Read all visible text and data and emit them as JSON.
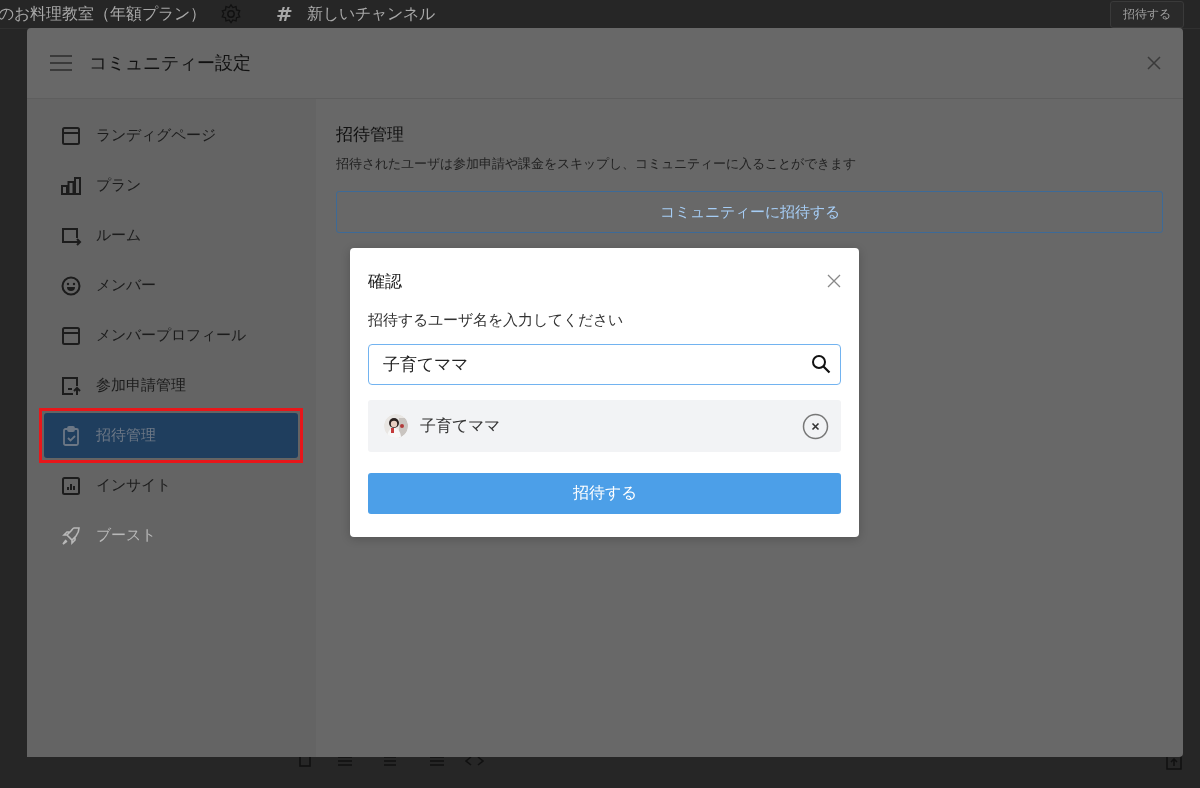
{
  "app_header": {
    "community_name": "のお料理教室（年額プラン）",
    "channel_symbol": "#",
    "channel_name": "新しいチャンネル",
    "action_button": "招待する"
  },
  "settings_modal": {
    "title": "コミュニティー設定",
    "sidebar": {
      "items": [
        {
          "label": "ランディグページ",
          "kind": "window",
          "selected": false,
          "disabled": false
        },
        {
          "label": "プラン",
          "kind": "bars",
          "selected": false,
          "disabled": false
        },
        {
          "label": "ルーム",
          "kind": "room",
          "selected": false,
          "disabled": false
        },
        {
          "label": "メンバー",
          "kind": "smile",
          "selected": false,
          "disabled": false
        },
        {
          "label": "メンバープロフィール",
          "kind": "window",
          "selected": false,
          "disabled": false
        },
        {
          "label": "参加申請管理",
          "kind": "upload",
          "selected": false,
          "disabled": false
        },
        {
          "label": "招待管理",
          "kind": "clipboard",
          "selected": true,
          "disabled": false
        },
        {
          "label": "インサイト",
          "kind": "chart",
          "selected": false,
          "disabled": false
        },
        {
          "label": "ブースト",
          "kind": "rocket",
          "selected": false,
          "disabled": true
        }
      ]
    },
    "content": {
      "title": "招待管理",
      "description": "招待されたユーザは参加申請や課金をスキップし、コミュニティーに入ることができます",
      "invite_button": "コミュニティーに招待する"
    }
  },
  "dialog": {
    "title": "確認",
    "prompt": "招待するユーザ名を入力してください",
    "search": {
      "value": "子育てママ"
    },
    "selected_users": [
      {
        "name": "子育てママ"
      }
    ],
    "submit_button": "招待する"
  }
}
